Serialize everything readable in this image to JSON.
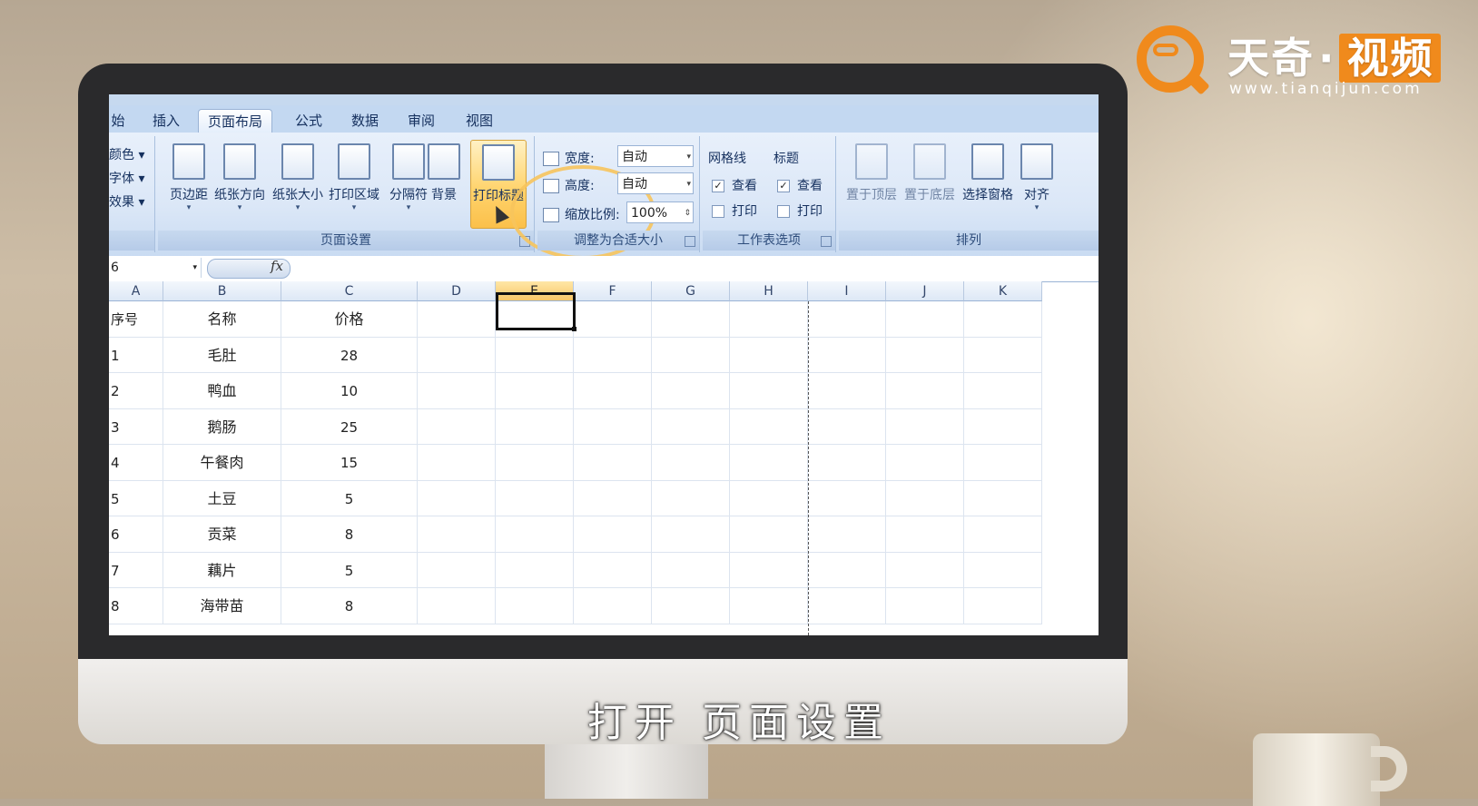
{
  "watermark": {
    "brand_a": "天奇",
    "dot": "·",
    "brand_b": "视频",
    "url": "www.tianqijun.com"
  },
  "subtitle": "打开 页面设置",
  "ribbon_tabs": [
    {
      "label": "始"
    },
    {
      "label": "插入"
    },
    {
      "label": "页面布局",
      "active": true
    },
    {
      "label": "公式"
    },
    {
      "label": "数据"
    },
    {
      "label": "审阅"
    },
    {
      "label": "视图"
    }
  ],
  "themes": {
    "items": [
      "颜色 ▾",
      "字体 ▾",
      "效果 ▾"
    ]
  },
  "page_setup": {
    "label": "页面设置",
    "buttons": [
      "页边距",
      "纸张方向",
      "纸张大小",
      "打印区域",
      "分隔符",
      "背景",
      "打印标题"
    ],
    "highlighted": "打印标题"
  },
  "scale_to_fit": {
    "label": "调整为合适大小",
    "width_label": "宽度:",
    "width_value": "自动",
    "height_label": "高度:",
    "height_value": "自动",
    "scale_label": "缩放比例:",
    "scale_value": "100%"
  },
  "sheet_options": {
    "label": "工作表选项",
    "gridlines_title": "网格线",
    "headings_title": "标题",
    "view_label": "查看",
    "print_label": "打印",
    "gridlines_view": true,
    "gridlines_print": false,
    "headings_view": true,
    "headings_print": false
  },
  "arrange": {
    "label": "排列",
    "buttons": [
      "置于顶层",
      "置于底层",
      "选择窗格",
      "对齐"
    ]
  },
  "formula_bar": {
    "name_box": "6",
    "fx": "fx",
    "value": ""
  },
  "columns": [
    "A",
    "B",
    "C",
    "D",
    "E",
    "F",
    "G",
    "H",
    "I",
    "J",
    "K"
  ],
  "selected_column": "E",
  "table": {
    "header": [
      "序号",
      "名称",
      "价格"
    ],
    "rows": [
      [
        "1",
        "毛肚",
        "28"
      ],
      [
        "2",
        "鸭血",
        "10"
      ],
      [
        "3",
        "鹅肠",
        "25"
      ],
      [
        "4",
        "午餐肉",
        "15"
      ],
      [
        "5",
        "土豆",
        "5"
      ],
      [
        "6",
        "贡菜",
        "8"
      ],
      [
        "7",
        "藕片",
        "5"
      ],
      [
        "8",
        "海带苗",
        "8"
      ]
    ]
  }
}
